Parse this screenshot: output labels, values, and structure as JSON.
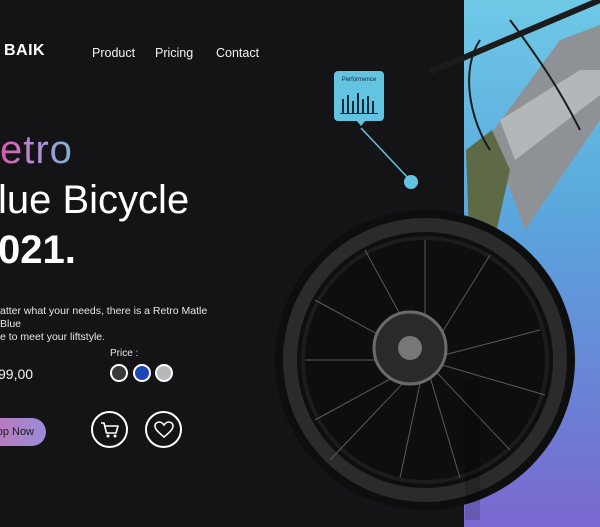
{
  "brand": {
    "name": "BAIK"
  },
  "nav": {
    "items": [
      "Product",
      "Pricing",
      "Contact"
    ]
  },
  "hero": {
    "line1": "etro",
    "line2": "lue Bicycle",
    "line3": "021."
  },
  "description": {
    "line1": "atter what your needs, there is a Retro Matle Blue",
    "line2": "e to meet your liftstyle."
  },
  "price": {
    "label": "Price :",
    "value": "99,00"
  },
  "colors": {
    "swatches": [
      "#3a3a3a",
      "#1f46b8",
      "#b8b8b8"
    ],
    "accent": "#63c4e2"
  },
  "actions": {
    "shop_label": "op Now"
  },
  "callout": {
    "title": "Performence"
  }
}
